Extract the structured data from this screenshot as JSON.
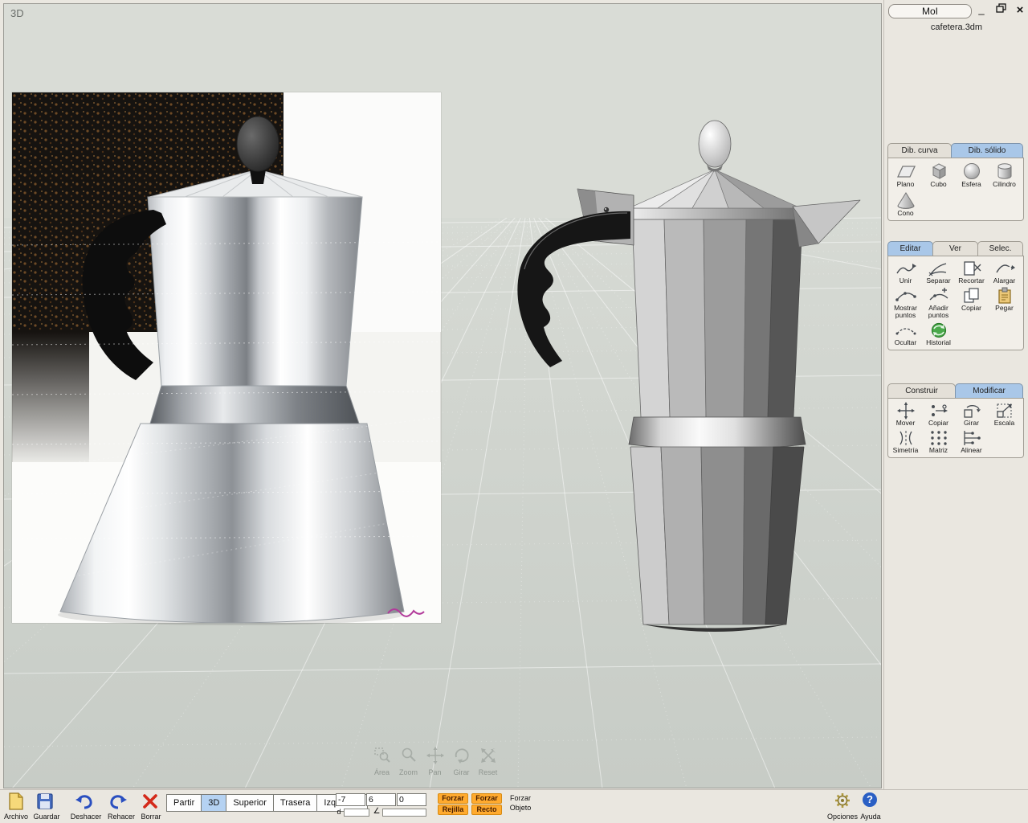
{
  "window": {
    "title": "MoI",
    "filename": "cafetera.3dm",
    "controls": [
      {
        "name": "minimize"
      },
      {
        "name": "maximize"
      },
      {
        "name": "close"
      }
    ]
  },
  "icons": {
    "minimize_glyph": "_",
    "close_glyph": "×",
    "angle_glyph": "∠",
    "help_glyph": "?"
  },
  "viewport": {
    "label": "3D",
    "content": "Reference photo of a metal moka coffee pot (left) and shaded 3D model of the same coffee pot (right) on a perspective grid",
    "nav_tools": [
      {
        "label": "Área"
      },
      {
        "label": "Zoom"
      },
      {
        "label": "Pan"
      },
      {
        "label": "Girar"
      },
      {
        "label": "Reset"
      }
    ]
  },
  "sidebar": {
    "draw_tabs": [
      {
        "label": "Dib. curva",
        "active": false
      },
      {
        "label": "Dib. sólido",
        "active": true
      }
    ],
    "solid_tools": [
      {
        "label": "Plano"
      },
      {
        "label": "Cubo"
      },
      {
        "label": "Esfera"
      },
      {
        "label": "Cilindro"
      },
      {
        "label": "Cono"
      }
    ],
    "edit_tabs": [
      {
        "label": "Editar",
        "active": true
      },
      {
        "label": "Ver",
        "active": false
      },
      {
        "label": "Selec.",
        "active": false
      }
    ],
    "edit_tools": [
      {
        "label": "Unir"
      },
      {
        "label": "Separar"
      },
      {
        "label": "Recortar"
      },
      {
        "label": "Alargar"
      },
      {
        "label": "Mostrar puntos"
      },
      {
        "label": "Añadir puntos"
      },
      {
        "label": "Copiar"
      },
      {
        "label": "Pegar"
      },
      {
        "label": "Ocultar"
      },
      {
        "label": "Historial"
      }
    ],
    "construct_tabs": [
      {
        "label": "Construir",
        "active": false
      },
      {
        "label": "Modificar",
        "active": true
      }
    ],
    "modify_tools": [
      {
        "label": "Mover"
      },
      {
        "label": "Copiar"
      },
      {
        "label": "Girar"
      },
      {
        "label": "Escala"
      },
      {
        "label": "Simetría"
      },
      {
        "label": "Matriz"
      },
      {
        "label": "Alinear"
      }
    ]
  },
  "bottombar": {
    "file": {
      "new_label": "Archivo",
      "save_label": "Guardar"
    },
    "history": {
      "undo_label": "Deshacer",
      "redo_label": "Rehacer"
    },
    "delete_label": "Borrar",
    "view_buttons": [
      {
        "label": "Partir",
        "active": false
      },
      {
        "label": "3D",
        "active": true
      },
      {
        "label": "Superior",
        "active": false
      },
      {
        "label": "Trasera",
        "active": false
      },
      {
        "label": "Izquierda",
        "active": false
      }
    ],
    "coords": {
      "x": "-7",
      "y": "6",
      "z": "0",
      "d_label": "d"
    },
    "snaps": [
      {
        "line1": "Forzar",
        "line2": "Rejilla",
        "active": true
      },
      {
        "line1": "Forzar",
        "line2": "Recto",
        "active": true
      },
      {
        "line1": "Forzar",
        "line2": "Objeto",
        "active": false
      }
    ],
    "help": {
      "options_label": "Opciones",
      "help_label": "Ayuda"
    }
  }
}
